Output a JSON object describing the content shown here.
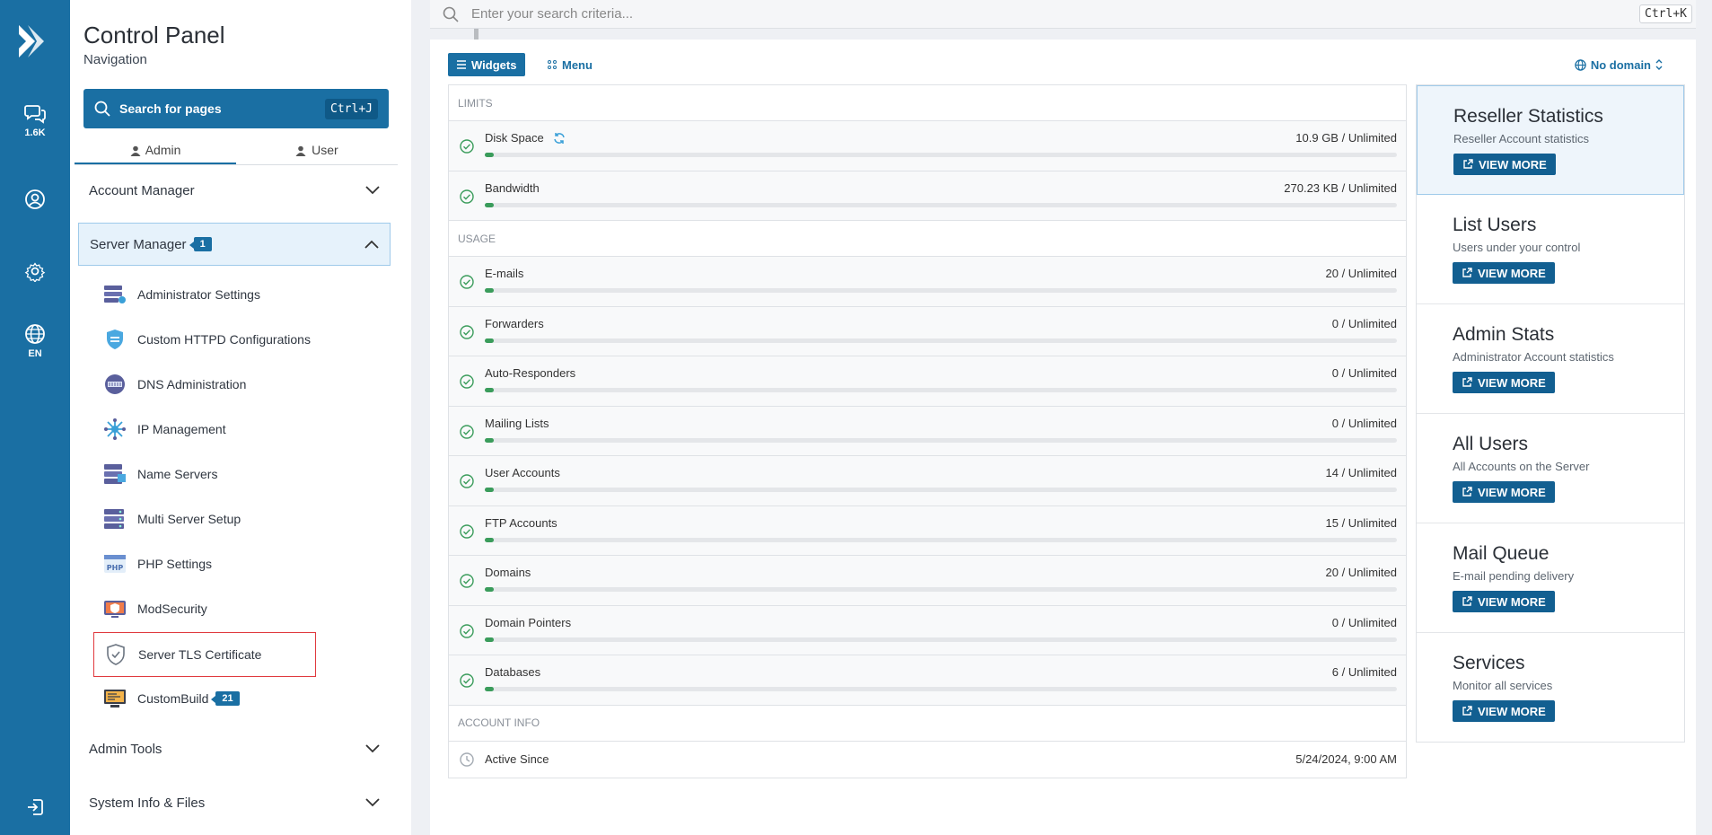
{
  "rail": {
    "messages_count": "1.6K",
    "language": "EN"
  },
  "nav": {
    "title": "Control Panel",
    "subtitle": "Navigation",
    "search_label": "Search for pages",
    "search_shortcut": "Ctrl+J",
    "tabs": [
      {
        "label": "Admin",
        "active": true
      },
      {
        "label": "User",
        "active": false
      }
    ],
    "sections": {
      "account_manager": "Account Manager",
      "server_manager": "Server Manager",
      "server_manager_badge": "1",
      "admin_tools": "Admin Tools",
      "system_info": "System Info & Files"
    },
    "server_items": [
      {
        "label": "Administrator Settings",
        "icon": "admin-settings-icon"
      },
      {
        "label": "Custom HTTPD Configurations",
        "icon": "httpd-shield-icon"
      },
      {
        "label": "DNS Administration",
        "icon": "dns-icon"
      },
      {
        "label": "IP Management",
        "icon": "ip-network-icon"
      },
      {
        "label": "Name Servers",
        "icon": "name-servers-icon"
      },
      {
        "label": "Multi Server Setup",
        "icon": "multi-server-icon"
      },
      {
        "label": "PHP Settings",
        "icon": "php-icon"
      },
      {
        "label": "ModSecurity",
        "icon": "modsecurity-icon"
      },
      {
        "label": "Server TLS Certificate",
        "icon": "tls-shield-icon",
        "selected": true
      },
      {
        "label": "CustomBuild",
        "icon": "custombuild-icon",
        "badge": "21"
      }
    ]
  },
  "topsearch": {
    "placeholder": "Enter your search criteria...",
    "shortcut": "Ctrl+K"
  },
  "toolbar": {
    "widgets_label": "Widgets",
    "menu_label": "Menu",
    "domain_label": "No domain"
  },
  "stats": {
    "limits_header": "LIMITS",
    "usage_header": "USAGE",
    "account_header": "ACCOUNT INFO",
    "limits": [
      {
        "label": "Disk Space",
        "value": "10.9 GB / Unlimited",
        "fill_pct": 1
      },
      {
        "label": "Bandwidth",
        "value": "270.23 KB / Unlimited",
        "fill_pct": 1
      }
    ],
    "usage": [
      {
        "label": "E-mails",
        "value": "20 / Unlimited",
        "fill_pct": 1
      },
      {
        "label": "Forwarders",
        "value": "0 / Unlimited",
        "fill_pct": 1
      },
      {
        "label": "Auto-Responders",
        "value": "0 / Unlimited",
        "fill_pct": 1
      },
      {
        "label": "Mailing Lists",
        "value": "0 / Unlimited",
        "fill_pct": 1
      },
      {
        "label": "User Accounts",
        "value": "14 / Unlimited",
        "fill_pct": 1
      },
      {
        "label": "FTP Accounts",
        "value": "15 / Unlimited",
        "fill_pct": 1
      },
      {
        "label": "Domains",
        "value": "20 / Unlimited",
        "fill_pct": 1
      },
      {
        "label": "Domain Pointers",
        "value": "0 / Unlimited",
        "fill_pct": 1
      },
      {
        "label": "Databases",
        "value": "6 / Unlimited",
        "fill_pct": 1
      }
    ],
    "account": {
      "label": "Active Since",
      "value": "5/24/2024, 9:00 AM"
    }
  },
  "cards": [
    {
      "title": "Reseller Statistics",
      "subtitle": "Reseller Account statistics",
      "button": "VIEW MORE"
    },
    {
      "title": "List Users",
      "subtitle": "Users under your control",
      "button": "VIEW MORE"
    },
    {
      "title": "Admin Stats",
      "subtitle": "Administrator Account statistics",
      "button": "VIEW MORE"
    },
    {
      "title": "All Users",
      "subtitle": "All Accounts on the Server",
      "button": "VIEW MORE"
    },
    {
      "title": "Mail Queue",
      "subtitle": "E-mail pending delivery",
      "button": "VIEW MORE"
    },
    {
      "title": "Services",
      "subtitle": "Monitor all services",
      "button": "VIEW MORE"
    }
  ],
  "colors": {
    "brand": "#1a6fa3",
    "success": "#3a9c5b",
    "selection_outline": "#e0393e"
  }
}
